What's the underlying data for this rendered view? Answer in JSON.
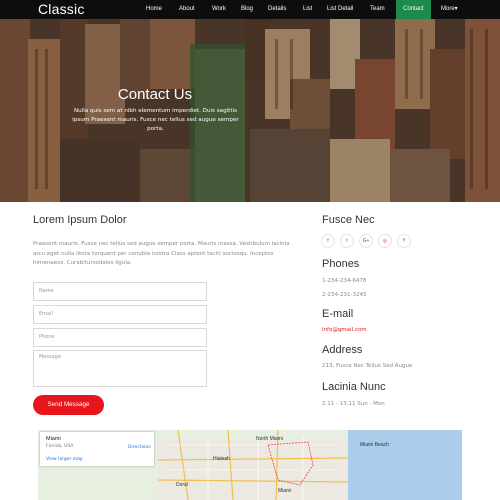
{
  "brand": "Classic",
  "nav": [
    "Home",
    "About",
    "Work",
    "Blog",
    "Details",
    "List",
    "List Detail",
    "Team",
    "Contact",
    "More▾"
  ],
  "hero": {
    "title": "Contact Us",
    "subtitle": "Nulla quis sem at nibh elementum imperdiet. Duis sagittis ipsum Praesent mauris. Fusce nec tellus sed augue semper porta."
  },
  "main": {
    "heading": "Lorem Ipsum Dolor",
    "paragraph": "Praesent mauris. Fusce nec tellus sed augue semper porta. Mauris massa. Vestibulum lacinia arcu eget nulla litora torquent per conubia nostra Class aptent taciti sociosqu. Inceptos himenaeos. Curabitursodales ligula.",
    "form": {
      "name_placeholder": "Name",
      "email_placeholder": "Email",
      "phone_placeholder": "Phone",
      "message_placeholder": "Message",
      "submit_label": "Send Message"
    }
  },
  "aside": {
    "social_heading": "Fusce Nec",
    "social_icons": [
      "f",
      "t",
      "G+",
      "◎",
      "Y"
    ],
    "phones_heading": "Phones",
    "phone_1": "1-234-234-6478",
    "phone_2": "2-234-231-3245",
    "email_heading": "E-mail",
    "email": "info@gmail.com",
    "address_heading": "Address",
    "address": "213, Fusce Nec Tellus Sed Augue",
    "hours_heading": "Lacinia Nunc",
    "hours": "2.11 - 13.11 Sun - Mon"
  },
  "map": {
    "city": "Miami",
    "state": "Florida, USA",
    "directions_label": "Directions",
    "larger_map_label": "View larger map",
    "labels": [
      "North Miami",
      "Miami Beach",
      "Hialeah",
      "Doral",
      "Miami"
    ]
  },
  "colors": {
    "accent_red": "#e8151c",
    "nav_active_green": "#1c8a4a",
    "nav_bg": "#0d0d0d"
  }
}
